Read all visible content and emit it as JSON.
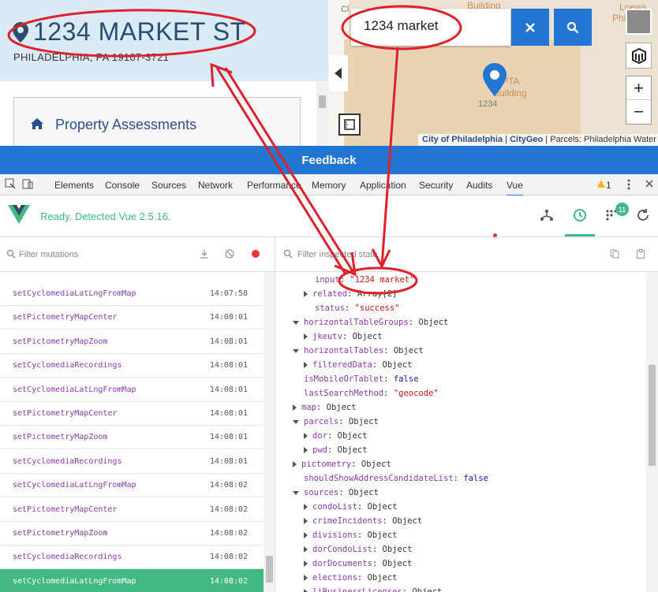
{
  "address": {
    "title": "1234 MARKET ST",
    "subtitle": "PHILADELPHIA, PA 19107-3721"
  },
  "topic": {
    "label": "Property Assessments"
  },
  "map": {
    "search_value": "1234 market",
    "labels": [
      "Building",
      "Loews",
      "Philade",
      "PTA",
      "Building",
      "1234",
      "Cl"
    ],
    "attribution_link1": "City of Philadelphia",
    "attribution_sep": " | ",
    "attribution_link2": "CityGeo",
    "attribution_rest": " | Parcels: Philadelphia Water",
    "zoom_in": "+",
    "zoom_out": "−"
  },
  "feedback": {
    "label": "Feedback"
  },
  "devtools": {
    "tabs": [
      "Elements",
      "Console",
      "Sources",
      "Network",
      "Performance",
      "Memory",
      "Application",
      "Security",
      "Audits",
      "Vue"
    ],
    "warning_count": "1"
  },
  "vue": {
    "status": "Ready. Detected Vue 2.5.16.",
    "badge": "11"
  },
  "filters": {
    "mutations_placeholder": "Filter mutations",
    "state_placeholder": "Filter inspected state"
  },
  "mutations": [
    {
      "name": "setCyclomediaLatLngFromMap",
      "time": "14:07:58"
    },
    {
      "name": "setPictometryMapCenter",
      "time": "14:08:01"
    },
    {
      "name": "setPictometryMapZoom",
      "time": "14:08:01"
    },
    {
      "name": "setCyclomediaRecordings",
      "time": "14:08:01"
    },
    {
      "name": "setCyclomediaLatLngFromMap",
      "time": "14:08:01"
    },
    {
      "name": "setPictometryMapCenter",
      "time": "14:08:01"
    },
    {
      "name": "setPictometryMapZoom",
      "time": "14:08:01"
    },
    {
      "name": "setCyclomediaRecordings",
      "time": "14:08:01"
    },
    {
      "name": "setCyclomediaLatLngFromMap",
      "time": "14:08:02"
    },
    {
      "name": "setPictometryMapCenter",
      "time": "14:08:02"
    },
    {
      "name": "setPictometryMapZoom",
      "time": "14:08:02"
    },
    {
      "name": "setCyclomediaRecordings",
      "time": "14:08:02"
    },
    {
      "name": "setCyclomediaLatLngFromMap",
      "time": "14:08:02"
    }
  ],
  "state": [
    {
      "k": "input",
      "v": "\"1234 market\"",
      "t": "s",
      "i": 1,
      "a": ""
    },
    {
      "k": "related",
      "v": "Array[2]",
      "t": "o",
      "i": 1,
      "a": "right"
    },
    {
      "k": "status",
      "v": "\"success\"",
      "t": "s",
      "i": 1,
      "a": ""
    },
    {
      "k": "horizontalTableGroups",
      "v": "Object",
      "t": "o",
      "i": 0,
      "a": "down"
    },
    {
      "k": "jkeutv",
      "v": "Object",
      "t": "o",
      "i": 1,
      "a": "right"
    },
    {
      "k": "horizontalTables",
      "v": "Object",
      "t": "o",
      "i": 0,
      "a": "down"
    },
    {
      "k": "filteredData",
      "v": "Object",
      "t": "o",
      "i": 1,
      "a": "right"
    },
    {
      "k": "isMobileOrTablet",
      "v": "false",
      "t": "b",
      "i": 0,
      "a": ""
    },
    {
      "k": "lastSearchMethod",
      "v": "\"geocode\"",
      "t": "s",
      "i": 0,
      "a": ""
    },
    {
      "k": "map",
      "v": "Object",
      "t": "o",
      "i": 0,
      "a": "right"
    },
    {
      "k": "parcels",
      "v": "Object",
      "t": "o",
      "i": 0,
      "a": "down"
    },
    {
      "k": "dor",
      "v": "Object",
      "t": "o",
      "i": 1,
      "a": "right"
    },
    {
      "k": "pwd",
      "v": "Object",
      "t": "o",
      "i": 1,
      "a": "right"
    },
    {
      "k": "pictometry",
      "v": "Object",
      "t": "o",
      "i": 0,
      "a": "right"
    },
    {
      "k": "shouldShowAddressCandidateList",
      "v": "false",
      "t": "b",
      "i": 0,
      "a": ""
    },
    {
      "k": "sources",
      "v": "Object",
      "t": "o",
      "i": 0,
      "a": "down"
    },
    {
      "k": "condoList",
      "v": "Object",
      "t": "o",
      "i": 1,
      "a": "right"
    },
    {
      "k": "crimeIncidents",
      "v": "Object",
      "t": "o",
      "i": 1,
      "a": "right"
    },
    {
      "k": "divisions",
      "v": "Object",
      "t": "o",
      "i": 1,
      "a": "right"
    },
    {
      "k": "dorCondoList",
      "v": "Object",
      "t": "o",
      "i": 1,
      "a": "right"
    },
    {
      "k": "dorDocuments",
      "v": "Object",
      "t": "o",
      "i": 1,
      "a": "right"
    },
    {
      "k": "elections",
      "v": "Object",
      "t": "o",
      "i": 1,
      "a": "right"
    },
    {
      "k": "liBusinessLicenses",
      "v": "Object",
      "t": "o",
      "i": 1,
      "a": "right"
    }
  ],
  "colors": {
    "accent_blue": "#2176d2",
    "vue_green": "#42b983",
    "annotation_red": "#e0202a"
  }
}
